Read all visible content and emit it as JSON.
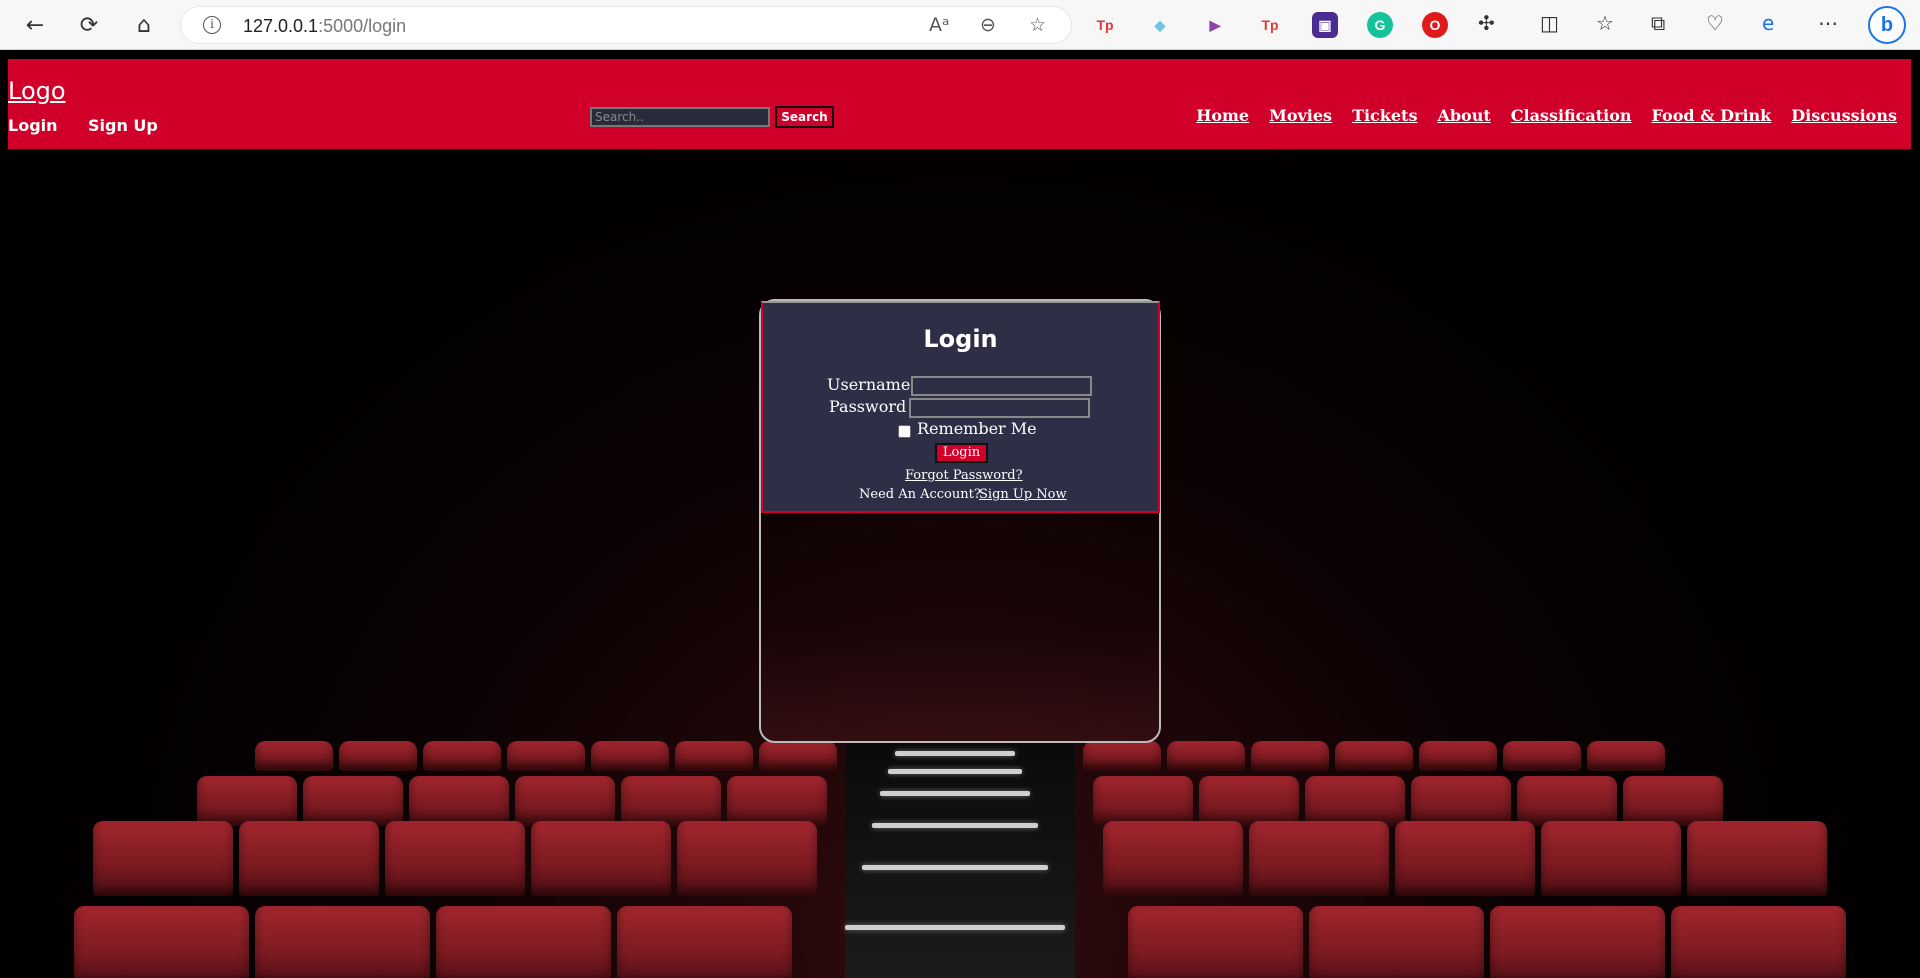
{
  "browser": {
    "url_host": "127.0.0.1",
    "url_rest": ":5000/login",
    "extensions": [
      {
        "icon": "tp-icon",
        "label": "Tp",
        "color": "#e53935"
      },
      {
        "icon": "shield-ext-icon",
        "label": "◆",
        "color": "#6ec6e6"
      },
      {
        "icon": "play-ext-icon",
        "label": "▶",
        "color": "#8e44ad"
      },
      {
        "icon": "tp2-icon",
        "label": "Tp",
        "color": "#e53935"
      },
      {
        "icon": "purple-ext-icon",
        "label": "▣",
        "color": "#4b2c91"
      },
      {
        "icon": "grammarly-icon",
        "label": "G",
        "color": "#15c39a"
      },
      {
        "icon": "opera-icon",
        "label": "O",
        "color": "#e0191a"
      }
    ]
  },
  "header": {
    "logo": "Logo",
    "login_link": "Login",
    "signup_link": "Sign Up",
    "search_placeholder": "Search..",
    "search_button": "Search",
    "nav": [
      "Home",
      "Movies",
      "Tickets",
      "About",
      "Classification",
      "Food & Drink",
      "Discussions"
    ]
  },
  "login_form": {
    "title": "Login",
    "username_label": "Username",
    "username_value": "",
    "password_label": "Password",
    "password_value": "",
    "remember_label": "Remember Me",
    "remember_checked": false,
    "submit_label": "Login",
    "forgot_link": "Forgot Password?",
    "need_account_text": "Need An Account?",
    "signup_now_link": "Sign Up Now"
  },
  "colors": {
    "brand_red": "#d0002a",
    "panel_bg": "#2e2f47"
  }
}
